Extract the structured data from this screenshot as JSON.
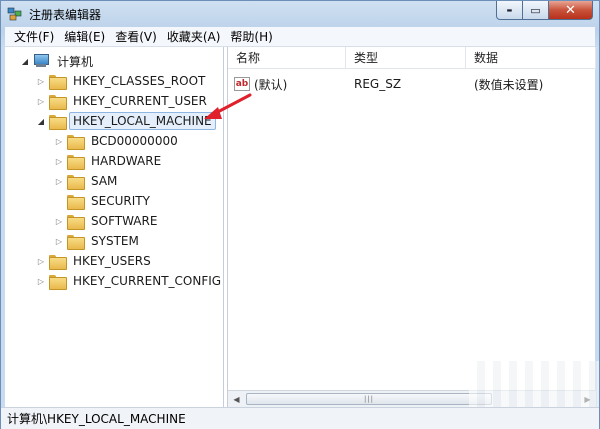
{
  "window": {
    "title": "注册表编辑器",
    "controls": {
      "minimize": "▬",
      "maximize": "▭",
      "close": "✕"
    }
  },
  "menu": [
    "文件(F)",
    "编辑(E)",
    "查看(V)",
    "收藏夹(A)",
    "帮助(H)"
  ],
  "tree": {
    "root": "计算机",
    "hives": [
      {
        "label": "HKEY_CLASSES_ROOT",
        "expanded": false
      },
      {
        "label": "HKEY_CURRENT_USER",
        "expanded": false
      },
      {
        "label": "HKEY_LOCAL_MACHINE",
        "expanded": true,
        "selected": true
      },
      {
        "label": "HKEY_USERS",
        "expanded": false
      },
      {
        "label": "HKEY_CURRENT_CONFIG",
        "expanded": false
      }
    ],
    "local_machine_children": [
      "BCD00000000",
      "HARDWARE",
      "SAM",
      "SECURITY",
      "SOFTWARE",
      "SYSTEM"
    ]
  },
  "list": {
    "columns": [
      "名称",
      "类型",
      "数据"
    ],
    "rows": [
      {
        "name": "(默认)",
        "type": "REG_SZ",
        "data": "(数值未设置)",
        "icon": "ab"
      }
    ]
  },
  "scrollbar": {
    "thumb_grip": "|||"
  },
  "status": {
    "path": "计算机\\HKEY_LOCAL_MACHINE"
  },
  "colors": {
    "annotation_arrow": "#e0202a",
    "selection": "#e4effb"
  }
}
